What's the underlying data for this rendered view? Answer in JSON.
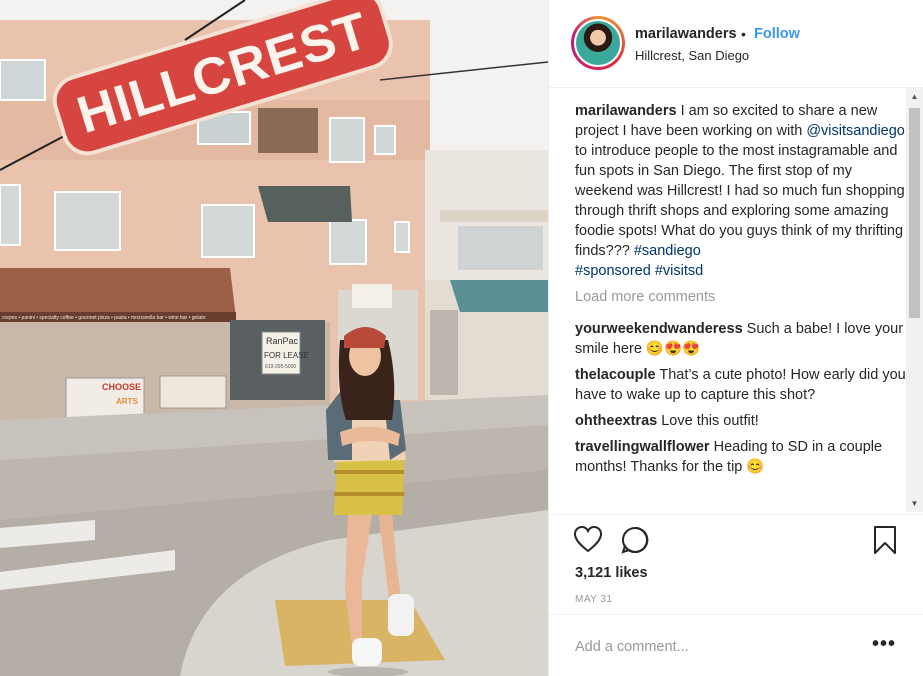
{
  "post": {
    "username": "marilawanders",
    "follow_dot": "•",
    "follow_label": "Follow",
    "location": "Hillcrest, San Diego",
    "caption": {
      "username": "marilawanders",
      "text_1": " I am so excited to share a new project I have been working on with ",
      "mention": "@visitsandiego",
      "text_2": " to introduce people to the most instagramable and fun spots in San Diego. The first stop of my weekend was Hillcrest! I had so much fun shopping through thrift shops and exploring some amazing foodie spots! What do you guys think of my thrifting finds??? ",
      "tag_1": "#sandiego",
      "tag_2": "#sponsored",
      "tag_3": "#visitsd"
    },
    "load_more": "Load more comments",
    "comments": [
      {
        "username": "yourweekendwanderess",
        "text": " Such a babe! I love your smile here 😊😍😍"
      },
      {
        "username": "thelacouple",
        "text": " That’s a cute photo! How early did you have to wake up to capture this shot?"
      },
      {
        "username": "ohtheextras",
        "text": " Love this outfit!"
      },
      {
        "username": "travellingwallflower",
        "text": " Heading to SD in a couple months! Thanks for the tip 😊"
      }
    ],
    "likes": "3,121 likes",
    "date": "MAY 31",
    "add_comment_placeholder": "Add a comment...",
    "more_label": "•••"
  },
  "photo": {
    "sign_text": "HILLCREST",
    "shop_sign_1": "RanPac",
    "shop_sign_2": "FOR LEASE",
    "shop_sign_3": "619-295-5000",
    "billboard_text": "CHOOSE",
    "billboard_text_2": "ARTS",
    "awning_text": "crepes • panini • specialty coffee • gourmet pizza • pasta • mozzarella bar • wine bar • gelato"
  },
  "icons": {
    "heart": "heart-icon",
    "comment": "comment-icon",
    "bookmark": "bookmark-icon",
    "more": "more-options-icon"
  },
  "colors": {
    "link": "#003569",
    "follow": "#3897f0",
    "muted": "#999999",
    "sign_red": "#d6453f"
  }
}
